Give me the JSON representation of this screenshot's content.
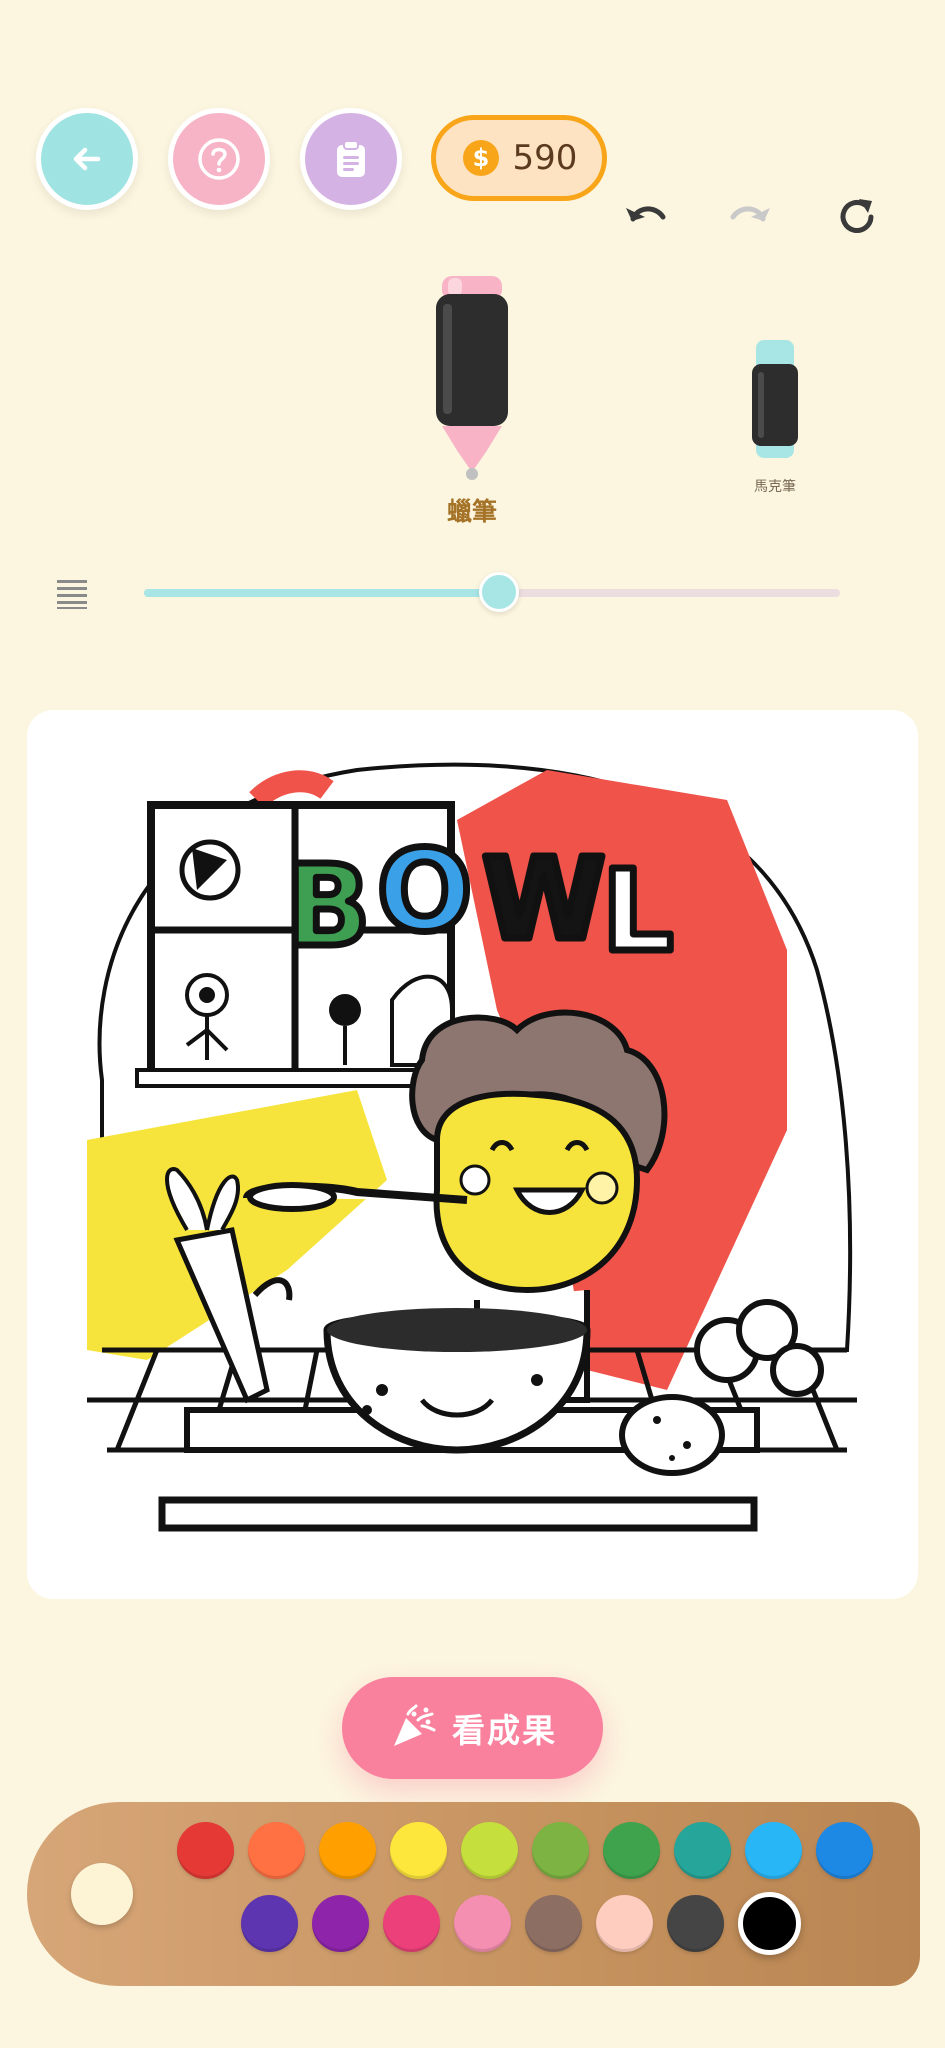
{
  "header": {
    "coins": "590"
  },
  "tools": [
    {
      "label": "蠟筆",
      "selected": true
    },
    {
      "label": "馬克筆",
      "selected": false
    }
  ],
  "brush_size": {
    "level": 0.51
  },
  "artwork": {
    "title_text": "BOWL"
  },
  "result_button": {
    "label": "看成果"
  },
  "palette": {
    "current_color": "#fdf4d6",
    "row1": [
      "#e53935",
      "#ff7043",
      "#ffa000",
      "#fde73c",
      "#c5df3c",
      "#7cb342",
      "#3fa34d",
      "#26a69a",
      "#29b6f6",
      "#1e88e5"
    ],
    "row2": [
      "#5e35b1",
      "#8e24aa",
      "#ec407a",
      "#f48fb1",
      "#8d6e63",
      "#ffcdbf",
      "#454545",
      "#000000"
    ],
    "selected_color": "#000000"
  },
  "colors": {
    "background": "#fcf6e0",
    "accent_teal": "#9fe3e2",
    "accent_pink": "#f9819d",
    "coin_orange": "#f8a51a"
  }
}
